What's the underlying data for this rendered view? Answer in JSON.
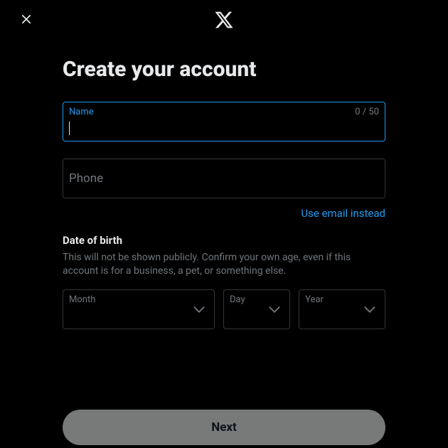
{
  "header": {
    "title": "Create your account"
  },
  "name_field": {
    "label": "Name",
    "char_count": "0 / 50"
  },
  "phone_field": {
    "placeholder": "Phone"
  },
  "email_link": "Use email instead",
  "dob": {
    "title": "Date of birth",
    "description": "This will not be shown publicly. Confirm your own age, even if this account is for a business, a pet, or something else.",
    "month_label": "Month",
    "day_label": "Day",
    "year_label": "Year"
  },
  "next_button": "Next"
}
